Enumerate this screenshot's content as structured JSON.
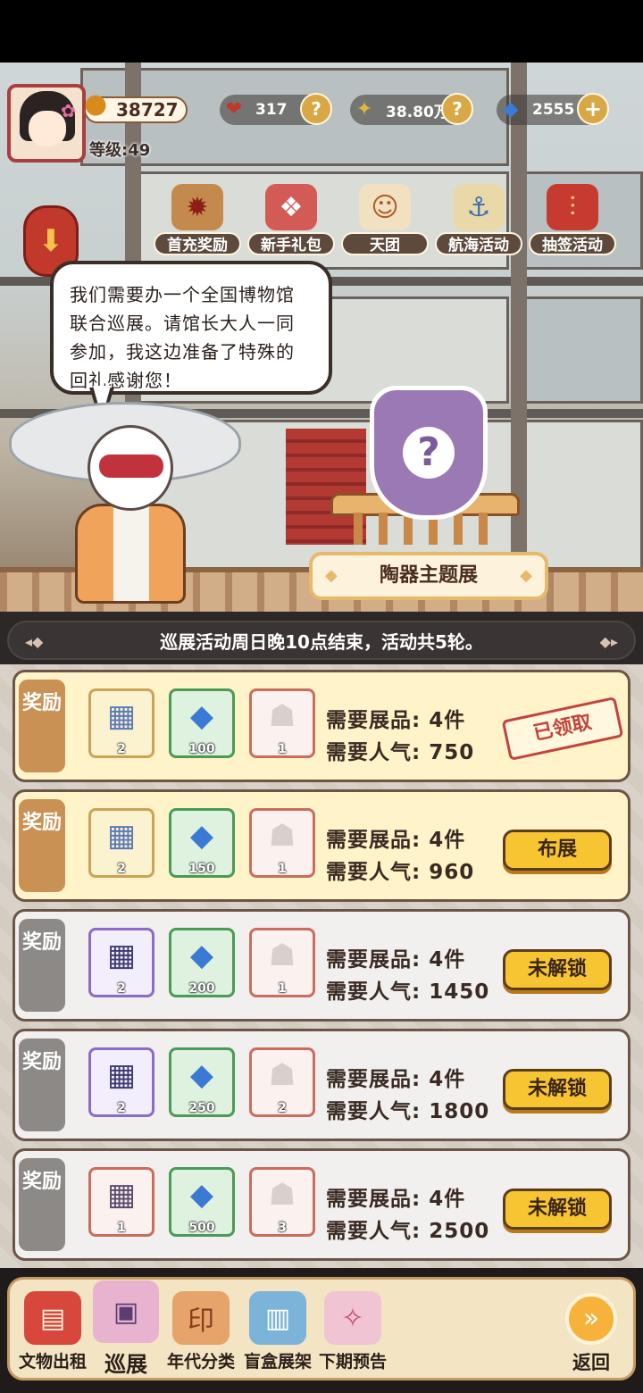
{
  "hud": {
    "gold": "38727",
    "level": "等级:49",
    "hearts": "317",
    "coins": "38.80万",
    "gems": "2555"
  },
  "shortcuts": [
    "首充奖励",
    "新手礼包",
    "天团",
    "航海活动",
    "抽签活动"
  ],
  "dialog": {
    "text": "我们需要办一个全国博物馆联合巡展。请馆长大人一同参加，我这边准备了特殊的回礼感谢您！"
  },
  "exhibit": {
    "theme": "陶器主题展"
  },
  "banner": {
    "text": "巡展活动周日晚10点结束，活动共5轮。"
  },
  "rewards": [
    {
      "label": "奖励",
      "items": [
        {
          "count": "2"
        },
        {
          "count": "100"
        },
        {
          "count": "1"
        }
      ],
      "need_items": "需要展品: 4件",
      "need_pop": "需要人气: 750",
      "status": "已领取"
    },
    {
      "label": "奖励",
      "items": [
        {
          "count": "2"
        },
        {
          "count": "150"
        },
        {
          "count": "1"
        }
      ],
      "need_items": "需要展品: 4件",
      "need_pop": "需要人气: 960",
      "status": "布展"
    },
    {
      "label": "奖励",
      "items": [
        {
          "count": "2"
        },
        {
          "count": "200"
        },
        {
          "count": "1"
        }
      ],
      "need_items": "需要展品: 4件",
      "need_pop": "需要人气: 1450",
      "status": "未解锁"
    },
    {
      "label": "奖励",
      "items": [
        {
          "count": "2"
        },
        {
          "count": "250"
        },
        {
          "count": "2"
        }
      ],
      "need_items": "需要展品: 4件",
      "need_pop": "需要人气: 1800",
      "status": "未解锁"
    },
    {
      "label": "奖励",
      "items": [
        {
          "count": "1"
        },
        {
          "count": "500"
        },
        {
          "count": "3"
        }
      ],
      "need_items": "需要展品: 4件",
      "need_pop": "需要人气: 2500",
      "status": "未解锁"
    }
  ],
  "nav": {
    "items": [
      "文物出租",
      "巡展",
      "年代分类",
      "盲盒展架",
      "下期预告"
    ],
    "back": "返回"
  }
}
